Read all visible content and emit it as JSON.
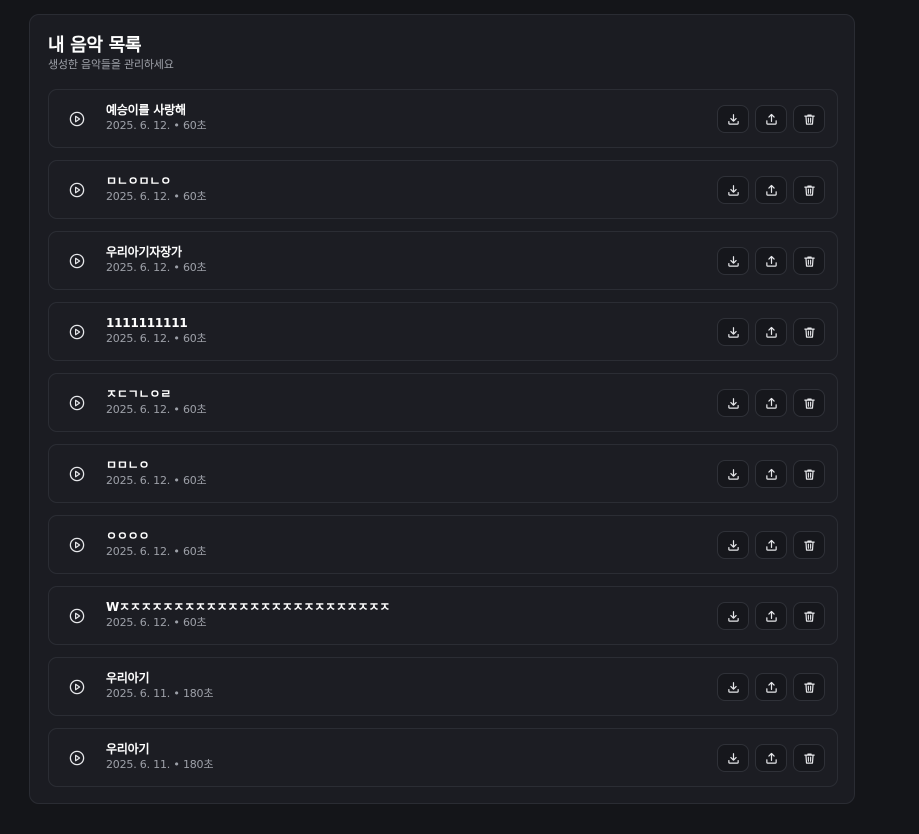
{
  "header": {
    "title": "내 음악 목록",
    "subtitle": "생성한 음악들을 관리하세요"
  },
  "colors": {
    "background": "#141519",
    "panel": "#1b1c22",
    "row": "#1c1d23",
    "text_primary": "#ffffff",
    "text_secondary": "#9da0a8"
  },
  "icons": {
    "play": "play-circle-icon",
    "download": "download-icon",
    "share": "share-icon",
    "delete": "trash-icon"
  },
  "tracks": [
    {
      "title": "예승이를 사랑해",
      "meta": "2025. 6. 12. • 60초"
    },
    {
      "title": "ㅁㄴㅇㅁㄴㅇ",
      "meta": "2025. 6. 12. • 60초"
    },
    {
      "title": "우리아기자장가",
      "meta": "2025. 6. 12. • 60초"
    },
    {
      "title": "1111111111",
      "meta": "2025. 6. 12. • 60초"
    },
    {
      "title": "ㅈㄷㄱㄴㅇㄹ",
      "meta": "2025. 6. 12. • 60초"
    },
    {
      "title": "ㅁㅁㄴㅇ",
      "meta": "2025. 6. 12. • 60초"
    },
    {
      "title": "ㅇㅇㅇㅇ",
      "meta": "2025. 6. 12. • 60초"
    },
    {
      "title": "Wㅈㅈㅈㅈㅈㅈㅈㅈㅈㅈㅈㅈㅈㅈㅈㅈㅈㅈㅈㅈㅈㅈㅈㅈㅈ",
      "meta": "2025. 6. 12. • 60초"
    },
    {
      "title": "우리아기",
      "meta": "2025. 6. 11. • 180초"
    },
    {
      "title": "우리아기",
      "meta": "2025. 6. 11. • 180초"
    }
  ]
}
